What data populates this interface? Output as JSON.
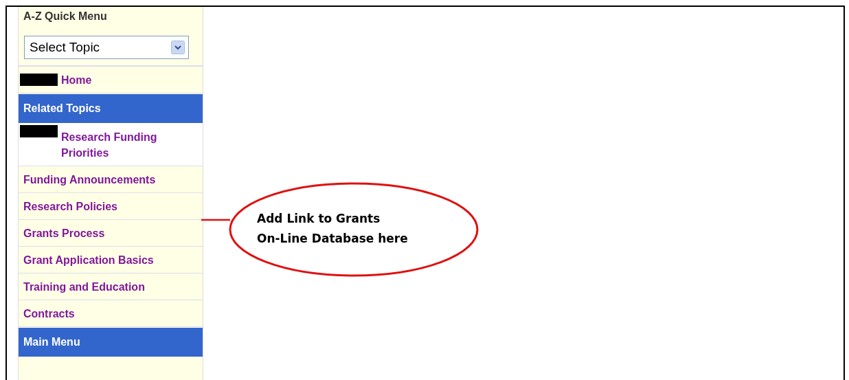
{
  "sidebar": {
    "title": "A-Z Quick Menu",
    "select": {
      "value": "Select Topic"
    },
    "items": [
      {
        "kind": "link",
        "label": "Home",
        "redacted": true,
        "highlighted": false
      },
      {
        "kind": "section",
        "label": "Related Topics"
      },
      {
        "kind": "link",
        "label": "Research Funding Priorities",
        "redacted": true,
        "highlighted": true
      },
      {
        "kind": "link",
        "label": "Funding Announcements",
        "redacted": false,
        "highlighted": false
      },
      {
        "kind": "link",
        "label": "Research Policies",
        "redacted": false,
        "highlighted": false
      },
      {
        "kind": "link",
        "label": "Grants Process",
        "redacted": false,
        "highlighted": false
      },
      {
        "kind": "link",
        "label": "Grant Application Basics",
        "redacted": false,
        "highlighted": false
      },
      {
        "kind": "link",
        "label": "Training and Education",
        "redacted": false,
        "highlighted": false
      },
      {
        "kind": "link",
        "label": "Contracts",
        "redacted": false,
        "highlighted": false
      },
      {
        "kind": "section",
        "label": "Main Menu"
      }
    ]
  },
  "callout": {
    "lines": [
      "Add Link to Grants",
      "On-Line Database here"
    ]
  }
}
